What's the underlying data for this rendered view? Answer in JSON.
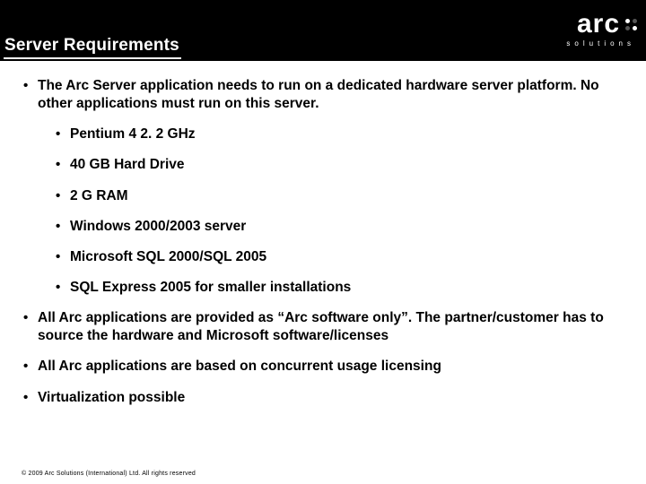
{
  "header": {
    "title": "Server Requirements",
    "logo": {
      "text": "arc",
      "subtitle": "solutions"
    }
  },
  "bullets": {
    "b0": "The Arc Server application needs to run on a dedicated hardware server platform. No other applications must run on this server.",
    "b0_sub": {
      "s0": "Pentium 4 2. 2 GHz",
      "s1": "40 GB Hard Drive",
      "s2": "2 G RAM",
      "s3": "Windows 2000/2003 server",
      "s4": "Microsoft SQL 2000/SQL 2005",
      "s5": "SQL Express 2005 for smaller installations"
    },
    "b1": "All Arc applications are provided as “Arc software only”. The partner/customer has to source the hardware and Microsoft software/licenses",
    "b2": "All Arc applications are based on concurrent usage licensing",
    "b3": "Virtualization possible"
  },
  "footer": "© 2009 Arc Solutions (International) Ltd. All rights reserved"
}
